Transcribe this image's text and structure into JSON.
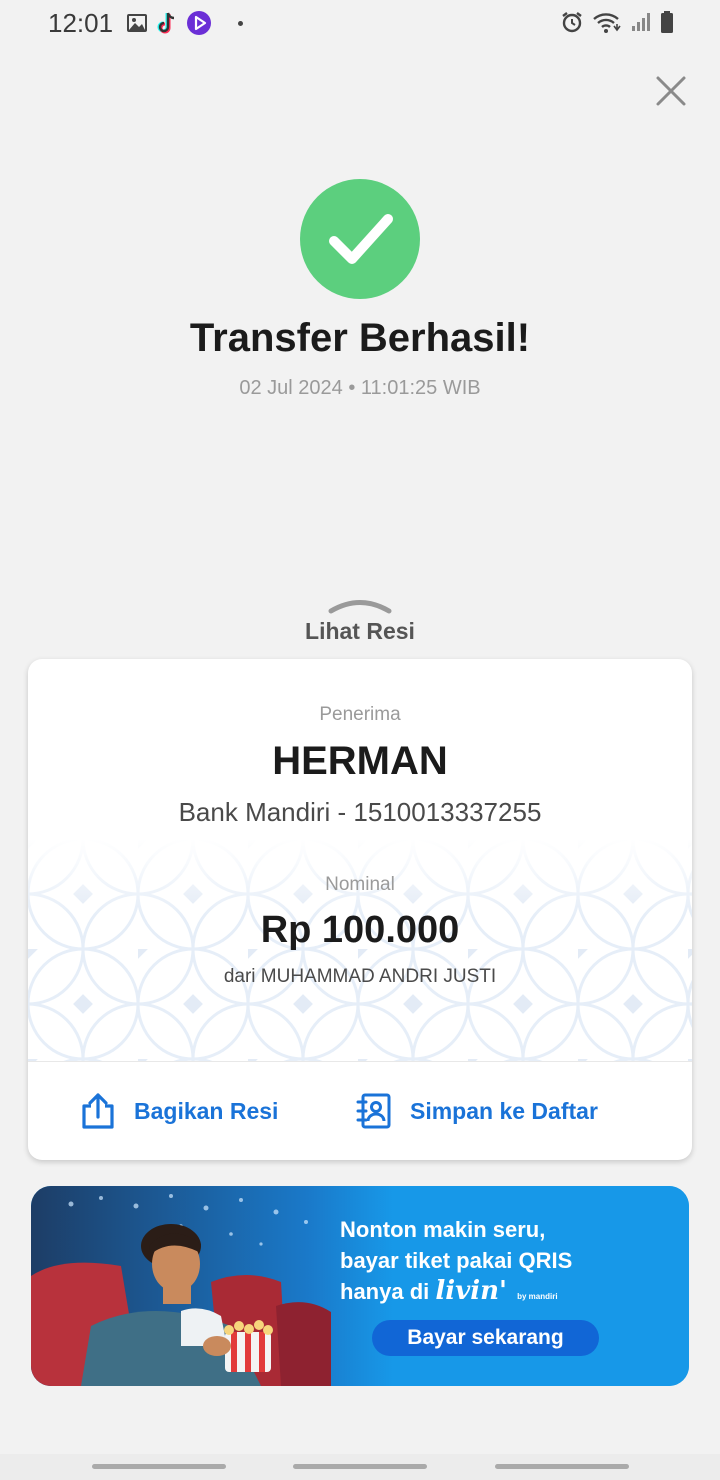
{
  "status_bar": {
    "time": "12:01",
    "left_icons": [
      "gallery-icon",
      "tiktok-icon",
      "video-player-icon",
      "dot"
    ],
    "right_icons": [
      "alarm-icon",
      "wifi-icon",
      "signal-icon",
      "battery-icon"
    ]
  },
  "result": {
    "title": "Transfer Berhasil!",
    "datetime": "02 Jul 2024 • 11:01:25 WIB"
  },
  "receipt_toggle": {
    "label": "Lihat Resi"
  },
  "receipt": {
    "recipient_label": "Penerima",
    "recipient_name": "HERMAN",
    "recipient_account": "Bank Mandiri - 1510013337255",
    "amount_label": "Nominal",
    "amount": "Rp 100.000",
    "sender": "dari MUHAMMAD ANDRI JUSTI"
  },
  "actions": {
    "share_label": "Bagikan Resi",
    "save_label": "Simpan ke Daftar"
  },
  "promo": {
    "line1": "Nonton makin seru,",
    "line2": "bayar tiket pakai QRIS",
    "line3": "hanya di",
    "brand": "livin'",
    "brand_sub": "by mandiri",
    "cta": "Bayar sekarang"
  },
  "colors": {
    "success": "#5ccf7e",
    "accent": "#1a73d8",
    "promo_bg": "#1798e8",
    "promo_cta": "#1166d6"
  }
}
